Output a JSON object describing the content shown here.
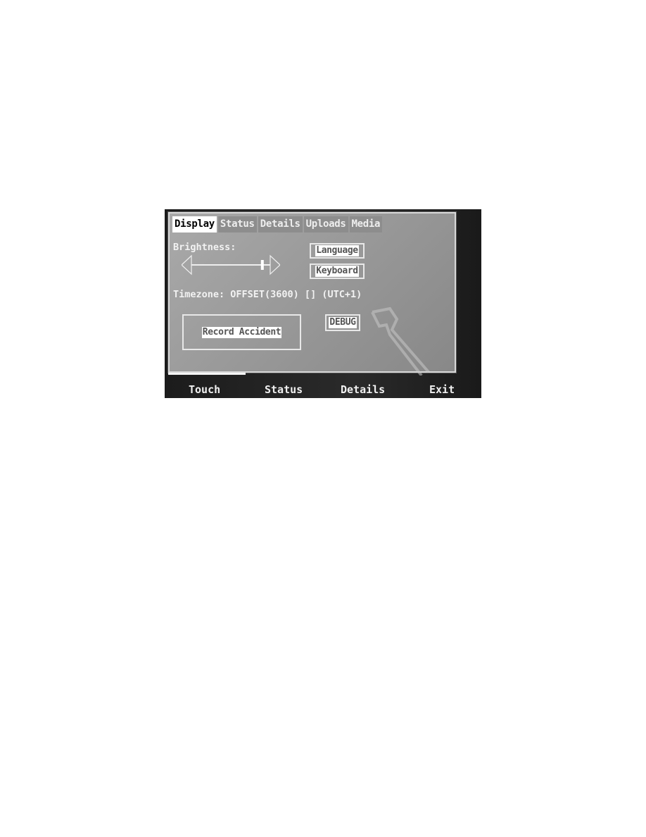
{
  "tabs": [
    {
      "label": "Display",
      "active": true
    },
    {
      "label": "Status",
      "active": false
    },
    {
      "label": "Details",
      "active": false
    },
    {
      "label": "Uploads",
      "active": false
    },
    {
      "label": "Media",
      "active": false
    }
  ],
  "display": {
    "brightness_label": "Brightness:",
    "brightness_level_percent": 90,
    "language_button": "Language",
    "keyboard_button": "Keyboard",
    "timezone_text": "Timezone: OFFSET(3600) [] (UTC+1)",
    "record_accident_button": "Record Accident",
    "debug_button": "DEBUG"
  },
  "page_progress_percent": 25,
  "softkeys": [
    "Touch",
    "Status",
    "Details",
    "Exit"
  ],
  "colors": {
    "panel_bg": "#9a9a9a",
    "active_tab_bg": "#ffffff",
    "inactive_tab_bg": "#8d8d8d",
    "device_bezel": "#222222"
  }
}
